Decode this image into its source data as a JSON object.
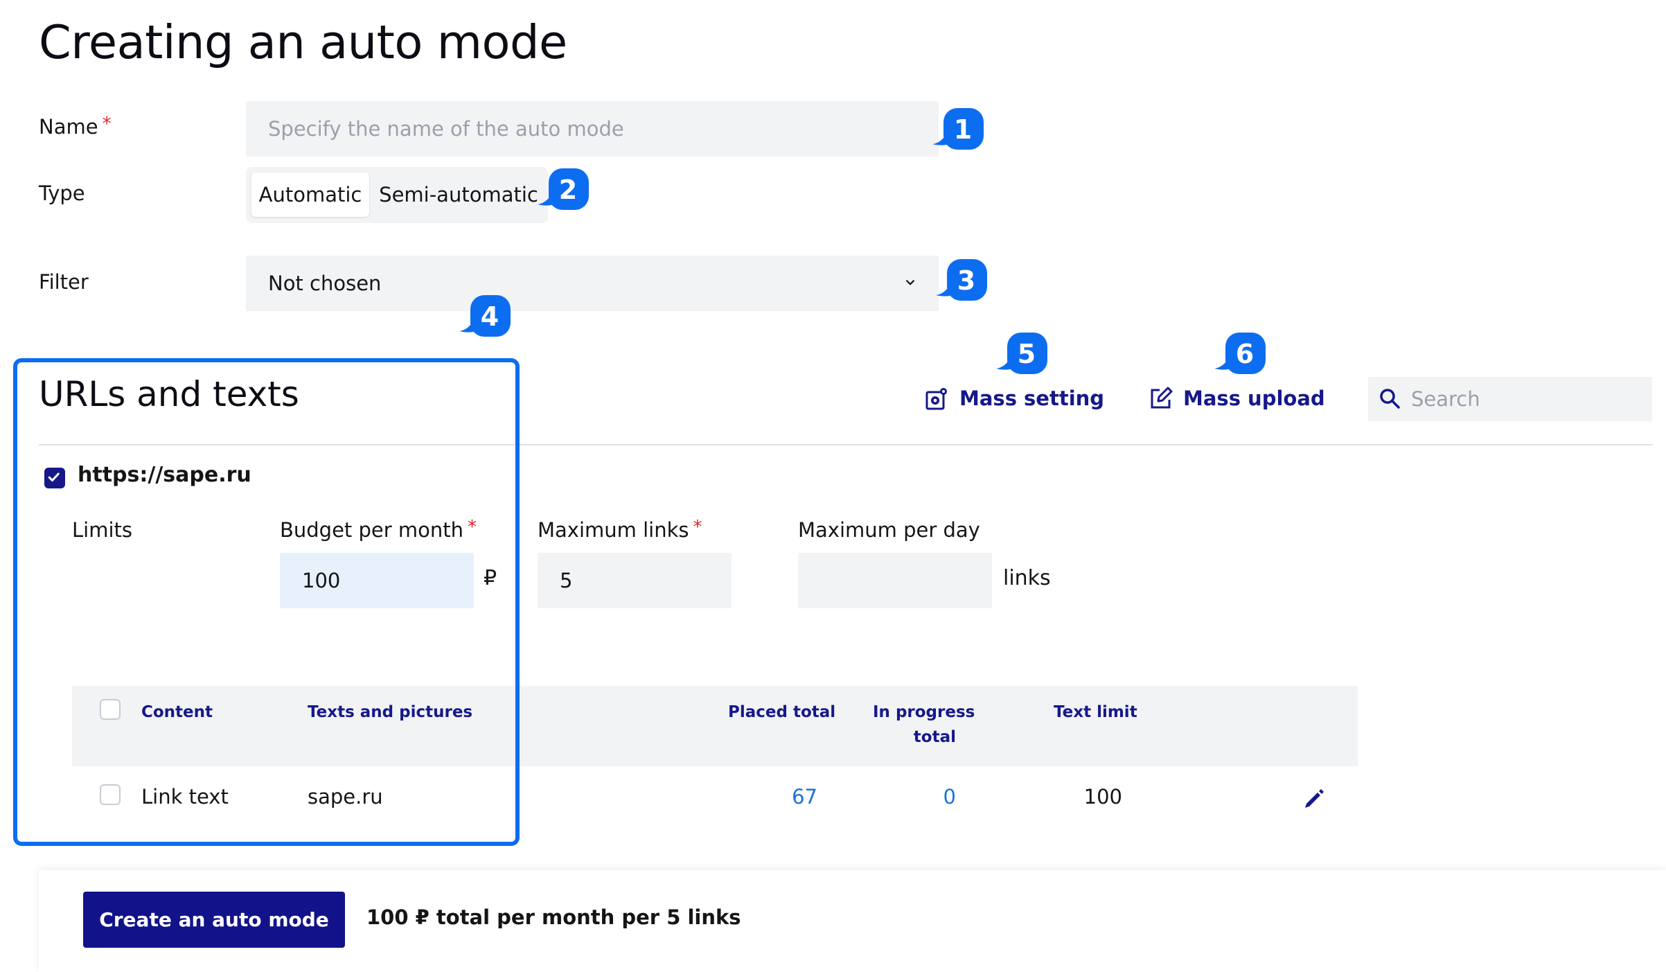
{
  "page": {
    "title": "Creating an auto mode"
  },
  "form": {
    "name_label": "Name",
    "required_mark": "*",
    "name_placeholder": "Specify the name of the auto mode",
    "type_label": "Type",
    "type_options": [
      "Automatic",
      "Semi-automatic"
    ],
    "type_selected": "Automatic",
    "filter_label": "Filter",
    "filter_value": "Not chosen"
  },
  "markers": [
    "1",
    "2",
    "3",
    "4",
    "5",
    "6"
  ],
  "section": {
    "title": "URLs and texts",
    "mass_setting": "Mass setting",
    "mass_upload": "Mass upload",
    "search_placeholder": "Search"
  },
  "site": {
    "url": "https://sape.ru",
    "checked": true,
    "limits_label": "Limits",
    "budget_label": "Budget per month",
    "budget_value": "100",
    "currency": "₽",
    "max_links_label": "Maximum links",
    "max_links_value": "5",
    "max_per_day_label": "Maximum per day",
    "max_per_day_value": "",
    "links_unit": "links"
  },
  "table": {
    "headers": {
      "content": "Content",
      "texts": "Texts and pictures",
      "placed": "Placed total",
      "in_progress_1": "In progress",
      "in_progress_2": "total",
      "text_limit": "Text limit"
    },
    "rows": [
      {
        "content": "Link text",
        "texts": "sape.ru",
        "placed": "67",
        "in_progress": "0",
        "text_limit": "100"
      }
    ]
  },
  "footer": {
    "create_button": "Create an auto mode",
    "summary": "100 ₽ total per month per 5 links"
  },
  "colors": {
    "primary": "#12138a",
    "accent_link": "#1a73d9",
    "marker": "#0d6df0",
    "required": "#e0252b"
  }
}
